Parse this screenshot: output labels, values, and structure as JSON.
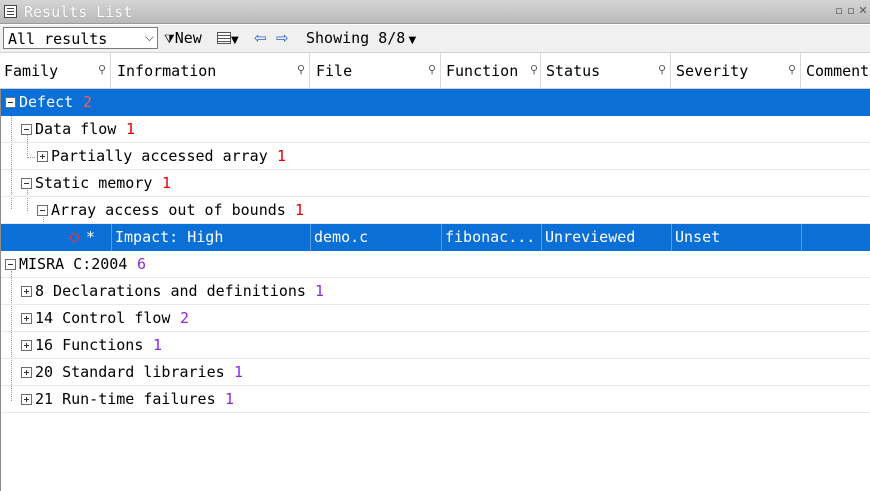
{
  "window": {
    "title": "Results List"
  },
  "toolbar": {
    "filter_value": "All results",
    "new_label": "New",
    "showing_label": "Showing 8/8"
  },
  "columns": [
    "Family",
    "Information",
    "File",
    "Function",
    "Status",
    "Severity",
    "Comment"
  ],
  "tree": {
    "defect": {
      "label": "Defect",
      "count": "2"
    },
    "data_flow": {
      "label": "Data flow",
      "count": "1"
    },
    "partial_array": {
      "label": "Partially accessed array",
      "count": "1"
    },
    "static_memory": {
      "label": "Static memory",
      "count": "1"
    },
    "array_oob": {
      "label": "Array access out of bounds",
      "count": "1"
    },
    "result": {
      "marker": "*",
      "information": "Impact: High",
      "file": "demo.c",
      "function": "fibonac...",
      "status": "Unreviewed",
      "severity": "Unset"
    },
    "misra": {
      "label": "MISRA C:2004",
      "count": "6"
    },
    "misra_groups": [
      {
        "label": "8 Declarations and definitions",
        "count": "1"
      },
      {
        "label": "14 Control flow",
        "count": "2"
      },
      {
        "label": "16 Functions",
        "count": "1"
      },
      {
        "label": "20 Standard libraries",
        "count": "1"
      },
      {
        "label": "21 Run-time failures",
        "count": "1"
      }
    ]
  },
  "colors": {
    "selection": "#0a6fd6",
    "defect_count": "#e00000",
    "misra_count": "#8a2be2"
  }
}
